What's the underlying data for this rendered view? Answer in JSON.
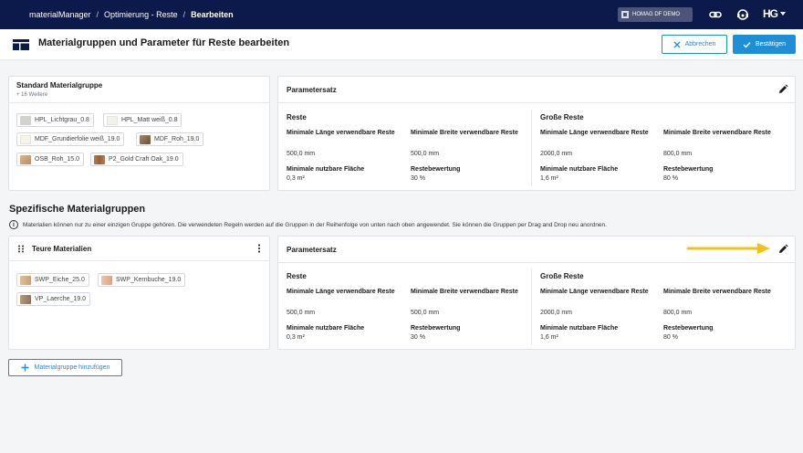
{
  "breadcrumb": {
    "items": [
      "materialManager",
      "Optimierung - Reste",
      "Bearbeiten"
    ],
    "separator": "/"
  },
  "topbar": {
    "tenant": "HOMAG DF DEMO",
    "logo": "HG",
    "icons": [
      "building-icon",
      "link-icon",
      "support-icon",
      "logo-dropdown-icon"
    ]
  },
  "header": {
    "title": "Materialgruppen und Parameter für Reste bearbeiten",
    "cancel_label": "Abbrechen",
    "confirm_label": "Bestätigen"
  },
  "standard": {
    "title": "Standard Materialgruppe",
    "subtitle": "+ 16 Weitere",
    "chips": [
      {
        "label": "HPL_Lichtgrau_0.8",
        "color": "#d4d2ce"
      },
      {
        "label": "HPL_Matt weiß_0.8",
        "color": "#f2f1ec"
      },
      {
        "label": "MDF_Grundierfolie weiß_19.0",
        "color": "#f5f3ea"
      },
      {
        "label": "MDF_Roh_19.0",
        "color": "#8f6a4e"
      },
      {
        "label": "OSB_Roh_15.0",
        "color": "#c9a27a"
      },
      {
        "label": "P2_Gold Craft Oak_19.0",
        "color": "#a86f46"
      }
    ]
  },
  "standard_params": {
    "title": "Parametersatz",
    "left": {
      "heading": "Reste",
      "min_len_label": "Minimale Länge verwendbare Reste",
      "min_len_value": "500,0 mm",
      "min_wid_label": "Minimale Breite verwendbare Reste",
      "min_wid_value": "500,0 mm",
      "min_area_label": "Minimale nutzbare Fläche",
      "min_area_value": "0,3 m²",
      "rating_label": "Restebewertung",
      "rating_value": "30 %"
    },
    "right": {
      "heading": "Große Reste",
      "min_len_label": "Minimale Länge verwendbare Reste",
      "min_len_value": "2000,0 mm",
      "min_wid_label": "Minimale Breite verwendbare Reste",
      "min_wid_value": "800,0 mm",
      "min_area_label": "Minimale nutzbare Fläche",
      "min_area_value": "1,6 m²",
      "rating_label": "Restebewertung",
      "rating_value": "80 %"
    }
  },
  "specific": {
    "section_title": "Spezifische Materialgruppen",
    "info": "Materialien können nur zu einer einzigen Gruppe gehören. Die verwendeten Regeln werden auf die Gruppen in der Reihenfolge von unten nach oben angewendet. Sie können die Gruppen per Drag and Drop neu anordnen.",
    "group_title": "Teure Materialien",
    "chips": [
      {
        "label": "SWP_Eiche_25.0",
        "color": "#d7b48a"
      },
      {
        "label": "SWP_Kernbuche_19.0",
        "color": "#e8b79a"
      },
      {
        "label": "VP_Laerche_19.0",
        "color": "#a7896a"
      }
    ],
    "add_label": "Materialgruppe hinzufügen"
  },
  "specific_params": {
    "title": "Parametersatz",
    "left": {
      "heading": "Reste",
      "min_len_label": "Minimale Länge verwendbare Reste",
      "min_len_value": "500,0 mm",
      "min_wid_label": "Minimale Breite verwendbare Reste",
      "min_wid_value": "500,0 mm",
      "min_area_label": "Minimale nutzbare Fläche",
      "min_area_value": "0,3 m²",
      "rating_label": "Restebewertung",
      "rating_value": "30 %"
    },
    "right": {
      "heading": "Große Reste",
      "min_len_label": "Minimale Länge verwendbare Reste",
      "min_len_value": "2000,0 mm",
      "min_wid_label": "Minimale Breite verwendbare Reste",
      "min_wid_value": "800,0 mm",
      "min_area_label": "Minimale nutzbare Fläche",
      "min_area_value": "1,6 m²",
      "rating_label": "Restebewertung",
      "rating_value": "80 %"
    }
  },
  "colors": {
    "nav": "#0b1a4a",
    "accent": "#1c8fd6",
    "highlight_arrow": "#f2c21b"
  }
}
